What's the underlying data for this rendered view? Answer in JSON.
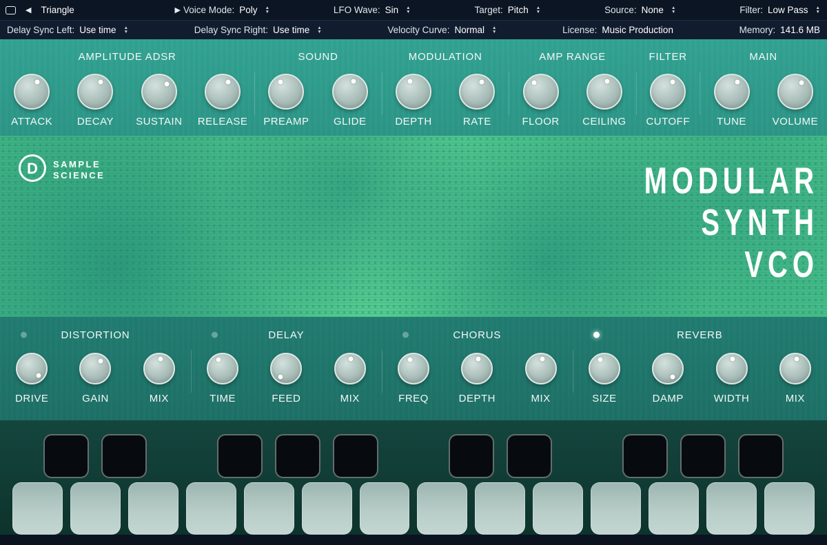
{
  "icons": {
    "prev": "◀",
    "next": "▶",
    "up": "▲",
    "down": "▼"
  },
  "menubar1": {
    "preset": "Triangle",
    "items": [
      {
        "label": "Voice Mode:",
        "value": "Poly"
      },
      {
        "label": "LFO Wave:",
        "value": "Sin"
      },
      {
        "label": "Target:",
        "value": "Pitch"
      },
      {
        "label": "Source:",
        "value": "None"
      },
      {
        "label": "Filter:",
        "value": "Low Pass"
      }
    ]
  },
  "menubar2": {
    "items": [
      {
        "label": "Delay Sync Left:",
        "value": "Use time",
        "arrows": true
      },
      {
        "label": "Delay Sync Right:",
        "value": "Use time",
        "arrows": true
      },
      {
        "label": "Velocity Curve:",
        "value": "Normal",
        "arrows": true
      },
      {
        "label": "License:",
        "value": "Music Production",
        "arrows": false
      },
      {
        "label": "Memory:",
        "value": "141.6 MB",
        "arrows": false
      }
    ]
  },
  "top_panel": {
    "sections": [
      {
        "title": "AMPLITUDE ADSR",
        "knobs": [
          {
            "label": "ATTACK",
            "angle": 30
          },
          {
            "label": "DECAY",
            "angle": 30
          },
          {
            "label": "SUSTAIN",
            "angle": 45
          },
          {
            "label": "RELEASE",
            "angle": 30
          }
        ]
      },
      {
        "title": "SOUND",
        "knobs": [
          {
            "label": "PREAMP",
            "angle": -30
          },
          {
            "label": "GLIDE",
            "angle": 20
          }
        ]
      },
      {
        "title": "MODULATION",
        "knobs": [
          {
            "label": "DEPTH",
            "angle": -20
          },
          {
            "label": "RATE",
            "angle": 25
          }
        ]
      },
      {
        "title": "AMP RANGE",
        "knobs": [
          {
            "label": "FLOOR",
            "angle": -35
          },
          {
            "label": "CEILING",
            "angle": 15
          }
        ]
      },
      {
        "title": "FILTER",
        "knobs": [
          {
            "label": "CUTOFF",
            "angle": 25
          }
        ]
      },
      {
        "title": "MAIN",
        "knobs": [
          {
            "label": "TUNE",
            "angle": 30
          },
          {
            "label": "VOLUME",
            "angle": 35
          }
        ]
      }
    ]
  },
  "banner": {
    "logo_line1": "SAMPLE",
    "logo_line2": "SCIENCE",
    "title_lines": [
      "MODULAR",
      "SYNTH",
      "VCO"
    ]
  },
  "fx_panel": {
    "sections": [
      {
        "title": "DISTORTION",
        "led_on": false,
        "knobs": [
          {
            "label": "DRIVE",
            "angle": 135
          },
          {
            "label": "GAIN",
            "angle": 35
          },
          {
            "label": "MIX",
            "angle": 10
          }
        ]
      },
      {
        "title": "DELAY",
        "led_on": false,
        "knobs": [
          {
            "label": "TIME",
            "angle": -25
          },
          {
            "label": "FEED",
            "angle": 215
          },
          {
            "label": "MIX",
            "angle": 5
          }
        ]
      },
      {
        "title": "CHORUS",
        "led_on": false,
        "knobs": [
          {
            "label": "FREQ",
            "angle": -20
          },
          {
            "label": "DEPTH",
            "angle": 5
          },
          {
            "label": "MIX",
            "angle": 10
          }
        ]
      },
      {
        "title": "REVERB",
        "led_on": true,
        "knobs": [
          {
            "label": "SIZE",
            "angle": -25
          },
          {
            "label": "DAMP",
            "angle": 150
          },
          {
            "label": "WIDTH",
            "angle": 5
          },
          {
            "label": "MIX",
            "angle": 10
          }
        ]
      }
    ]
  },
  "keyboard": {
    "white_key_count": 14,
    "black_key_slots": [
      0,
      1,
      3,
      4,
      5,
      7,
      8,
      10,
      11,
      12
    ]
  },
  "colors": {
    "menubar_bg": "#0c1523",
    "panel_teal": "#2f9f8e",
    "banner_green": "#52c98c",
    "fx_teal": "#1f786e",
    "keyboard_bg": "#0f3a33",
    "led_on": "#ffffff"
  }
}
